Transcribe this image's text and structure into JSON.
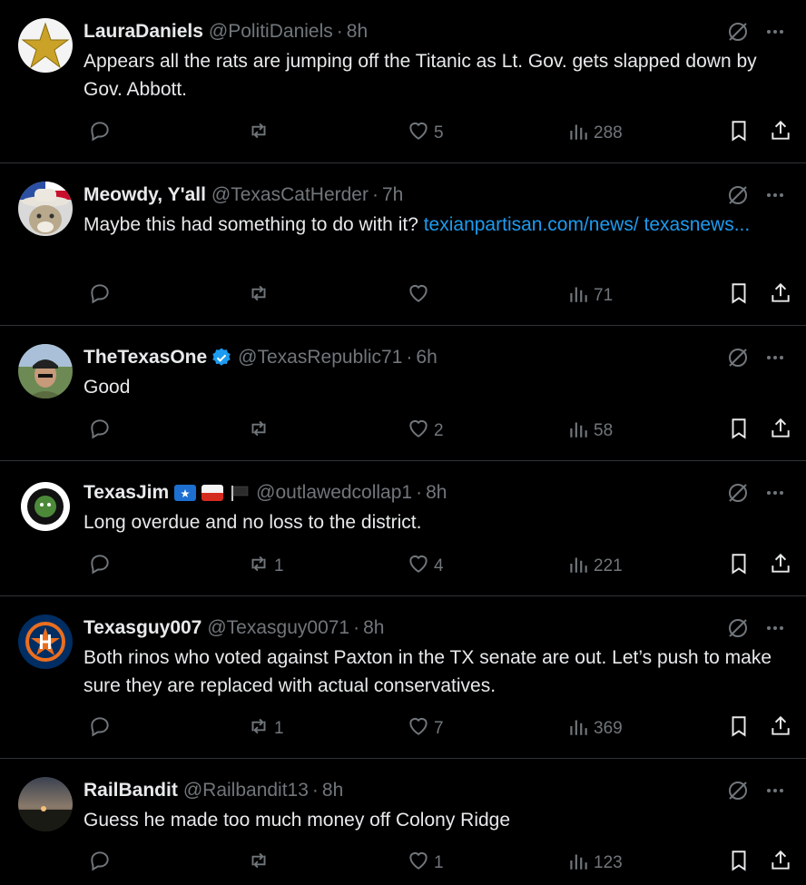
{
  "colors": {
    "background": "#000000",
    "text": "#e7e9ea",
    "muted": "#71767b",
    "link": "#1d9bf0",
    "verified": "#1d9bf0",
    "divider": "#2f3336"
  },
  "tweets": [
    {
      "name": "LauraDaniels",
      "handle": "@PolitiDaniels",
      "separator": "·",
      "time": "8h",
      "text": "Appears all the rats are jumping off the Titanic as Lt. Gov. gets slapped down by Gov.  Abbott.",
      "link": "",
      "replies": "",
      "reposts": "",
      "likes": "5",
      "views": "288",
      "avatar_icon": "gold-star-avatar"
    },
    {
      "name": "Meowdy, Y'all",
      "handle": "@TexasCatHerder",
      "separator": "·",
      "time": "7h",
      "text": "Maybe this had something to do with it?  ",
      "link": "texianpartisan.com/news/ texasnews...",
      "replies": "",
      "reposts": "",
      "likes": "",
      "views": "71",
      "avatar_icon": "cat-cowboy-hat-avatar"
    },
    {
      "name": "TheTexasOne",
      "handle": "@TexasRepublic71",
      "separator": "·",
      "time": "6h",
      "text": "Good",
      "link": "",
      "replies": "",
      "reposts": "",
      "likes": "2",
      "views": "58",
      "verified": true,
      "avatar_icon": "man-cap-avatar"
    },
    {
      "name": "TexasJim",
      "handle": "@outlawedcollap1",
      "separator": "·",
      "time": "8h",
      "text": "Long overdue and no loss to the district.",
      "link": "",
      "replies": "",
      "reposts": "1",
      "likes": "4",
      "views": "221",
      "flags": [
        "texas-flag-icon",
        "chile-flag-icon",
        "black-flag-icon"
      ],
      "avatar_icon": "meme-squad-avatar"
    },
    {
      "name": "Texasguy007",
      "handle": "@Texasguy0071",
      "separator": "·",
      "time": "8h",
      "text": "Both rinos who voted against Paxton in the TX senate are out. Let’s push to make sure they are replaced with actual conservatives.",
      "link": "",
      "replies": "",
      "reposts": "1",
      "likes": "7",
      "views": "369",
      "avatar_icon": "astros-logo-avatar"
    },
    {
      "name": "RailBandit",
      "handle": "@Railbandit13",
      "separator": "·",
      "time": "8h",
      "text": "Guess he made too much money off Colony Ridge",
      "link": "",
      "replies": "",
      "reposts": "",
      "likes": "1",
      "views": "123",
      "avatar_icon": "sunset-avatar"
    }
  ]
}
